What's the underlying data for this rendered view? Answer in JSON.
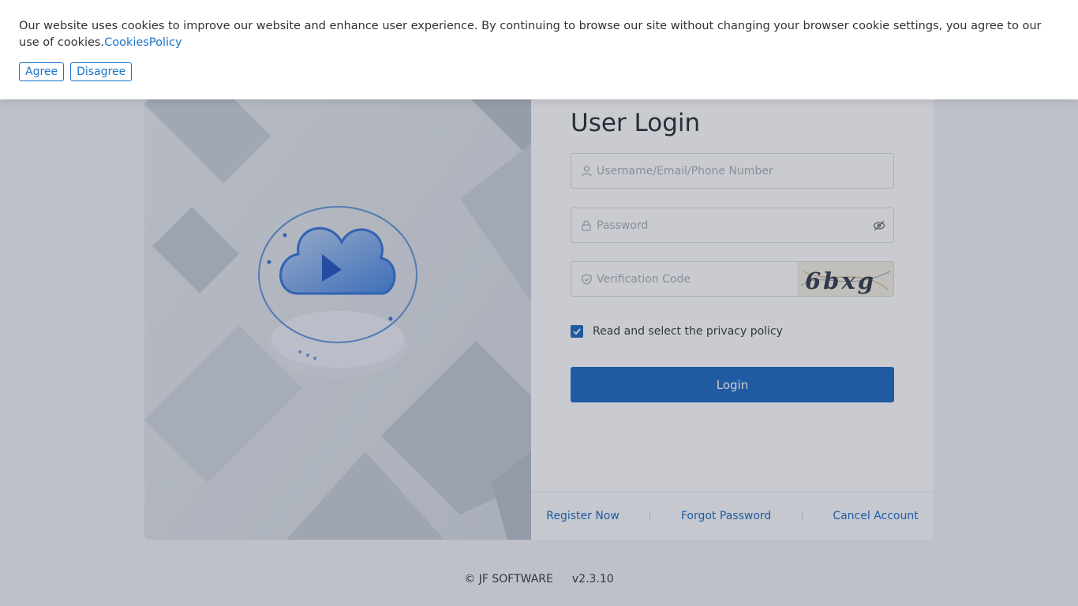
{
  "cookie_banner": {
    "text": "Our website uses cookies to improve our website and enhance user experience. By continuing to browse our site without changing your browser cookie settings, you agree to our use of cookies.",
    "policy_link": "CookiesPolicy",
    "agree_label": "Agree",
    "disagree_label": "Disagree"
  },
  "login": {
    "title": "User Login",
    "username_placeholder": "Username/Email/Phone Number",
    "password_placeholder": "Password",
    "verification_placeholder": "Verification Code",
    "captcha_text": "6bxg",
    "privacy_label": "Read and select the privacy policy",
    "privacy_checked": true,
    "login_button": "Login"
  },
  "footer_links": {
    "register": "Register Now",
    "forgot": "Forgot Password",
    "cancel": "Cancel Account"
  },
  "copyright": {
    "owner": "© JF SOFTWARE",
    "version": "v2.3.10"
  },
  "colors": {
    "primary": "#1565c0",
    "link": "#1a73c8"
  },
  "icons": {
    "username": "user-icon",
    "password": "lock-icon",
    "verification": "shield-icon",
    "toggle_password": "eye-off-icon",
    "checkbox": "checkmark-icon"
  }
}
